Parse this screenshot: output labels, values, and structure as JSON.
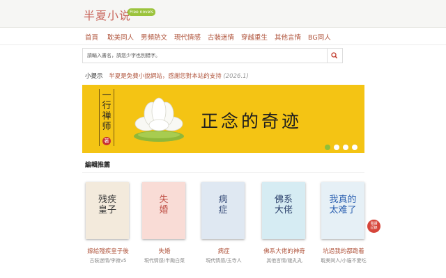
{
  "header": {
    "logo": "半夏小说",
    "badge": "Free novels"
  },
  "nav": {
    "items": [
      "首頁",
      "耽美同人",
      "男頻熱文",
      "現代情感",
      "古裝迷情",
      "穿越重生",
      "其他言情",
      "BG同人"
    ]
  },
  "search": {
    "value": "請輸入書名，請您少字也別錯字。",
    "button_icon": "search-icon"
  },
  "tip": {
    "label": "小提示",
    "text": "半夏是免費小說網站，感謝您對本站的支持",
    "year": "(2026.1)"
  },
  "banner": {
    "vertical_text": "一行禅师",
    "seal": "著",
    "title": "正念的奇迹",
    "slides": 4,
    "active_slide": 0,
    "colors": {
      "background": "#f4c414",
      "active_dot": "#8fbf3a"
    }
  },
  "section": {
    "title": "編輯推薦"
  },
  "books": [
    {
      "title": "嫁給殘疾皇子後",
      "meta": "古裝迷情/李寂v5",
      "cover_text": "残疾\n皇子",
      "cover_bg": "#f3eadc",
      "cover_fg": "#3a3a3a"
    },
    {
      "title": "失婚",
      "meta": "現代情感/半颱白菜",
      "cover_text": "失\n婚",
      "cover_bg": "#f9dcd6",
      "cover_fg": "#c0544a"
    },
    {
      "title": "病症",
      "meta": "現代情感/玉寺人",
      "cover_text": "病\n症",
      "cover_bg": "#dfe8f2",
      "cover_fg": "#3a4e7a"
    },
    {
      "title": "佛系大佬的神奇",
      "meta": "其他言情/幾丸丸",
      "cover_text": "佛系\n大佬",
      "cover_bg": "#d6ecf3",
      "cover_fg": "#2a3f6a"
    },
    {
      "title": "坑過我的都跪着",
      "meta": "耽美同人/小貓不愛吃",
      "cover_text": "我真的\n太难了",
      "cover_bg": "#e6f0f6",
      "cover_fg": "#2a5fb0"
    }
  ],
  "float_button": {
    "line1": "閱讀",
    "line2": "記錄"
  }
}
